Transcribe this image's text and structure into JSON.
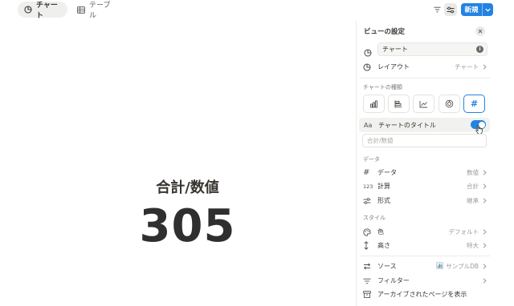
{
  "topbar": {
    "tabs": [
      {
        "label": "チャート",
        "icon": "chart-pie-icon",
        "active": true
      },
      {
        "label": "テーブル",
        "icon": "table-icon",
        "active": false
      }
    ],
    "new_button_label": "新規"
  },
  "main": {
    "title": "合計/数値",
    "value": "305"
  },
  "panel": {
    "title": "ビューの設定",
    "name_value": "チャート",
    "layout": {
      "label": "レイアウト",
      "value": "チャート"
    },
    "chart_type_label": "チャートの種類",
    "chart_types": [
      "vertical-bar",
      "horizontal-bar",
      "line",
      "donut",
      "number"
    ],
    "selected_chart_type": "number",
    "title_toggle_label": "チャートのタイトル",
    "title_toggle_on": true,
    "title_placeholder": "合計/数値",
    "data_section": "データ",
    "data_rows": [
      {
        "icon_text": "#",
        "label": "データ",
        "value": "数値"
      },
      {
        "icon_text": "123",
        "label": "計算",
        "value": "合計"
      },
      {
        "icon_text": "",
        "label": "形式",
        "value": "継承"
      }
    ],
    "style_section": "スタイル",
    "style_rows": [
      {
        "label": "色",
        "value": "デフォルト"
      },
      {
        "label": "高さ",
        "value": "特大"
      }
    ],
    "source": {
      "label": "ソース",
      "value": "サンプルDB"
    },
    "filter_label": "フィルター",
    "archive_label": "アーカイブされたページを表示"
  },
  "colors": {
    "accent": "#2383e2",
    "text": "#37352f",
    "muted": "#9b9a97"
  }
}
